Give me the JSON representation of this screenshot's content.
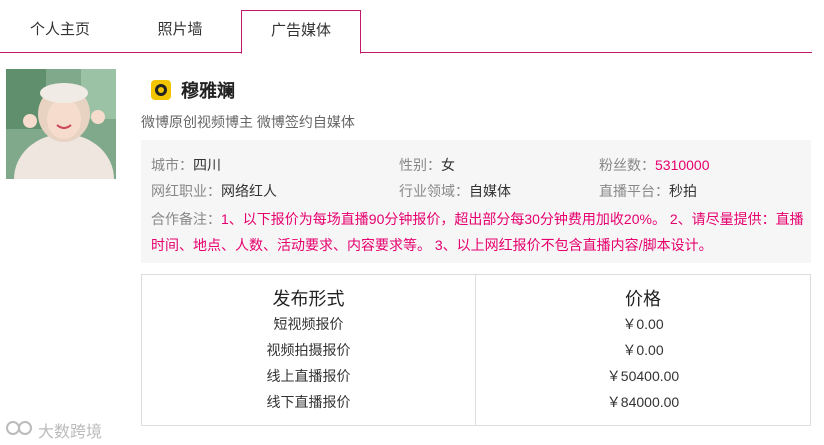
{
  "tabs": [
    {
      "label": "个人主页"
    },
    {
      "label": "照片墙"
    },
    {
      "label": "广告媒体"
    }
  ],
  "profile": {
    "name": "穆雅斓",
    "platform_icon": "weibo-icon",
    "subtitle": "微博原创视频博主 微博签约自媒体"
  },
  "info": {
    "city_label": "城市：",
    "city": "四川",
    "gender_label": "性别：",
    "gender": "女",
    "fans_label": "粉丝数：",
    "fans": "5310000",
    "job_label": "网红职业：",
    "job": "网络红人",
    "industry_label": "行业领域：",
    "industry": "自媒体",
    "live_label": "直播平台：",
    "live": "秒拍",
    "note_label": "合作备注：",
    "note": "1、以下报价为每场直播90分钟报价，超出部分每30分钟费用加收20%。 2、请尽量提供：直播时间、地点、人数、活动要求、内容要求等。 3、以上网红报价不包含直播内容/脚本设计。"
  },
  "price_table": {
    "col1_header": "发布形式",
    "col2_header": "价格",
    "rows": [
      {
        "form": "短视频报价",
        "price": "￥0.00"
      },
      {
        "form": "视频拍摄报价",
        "price": "￥0.00"
      },
      {
        "form": "线上直播报价",
        "price": "￥50400.00"
      },
      {
        "form": "线下直播报价",
        "price": "￥84000.00"
      }
    ]
  },
  "watermark": "大数跨境",
  "colors": {
    "accent": "#e5006e",
    "tab_border": "#c2186b",
    "panel_bg": "#f6f6f6"
  }
}
